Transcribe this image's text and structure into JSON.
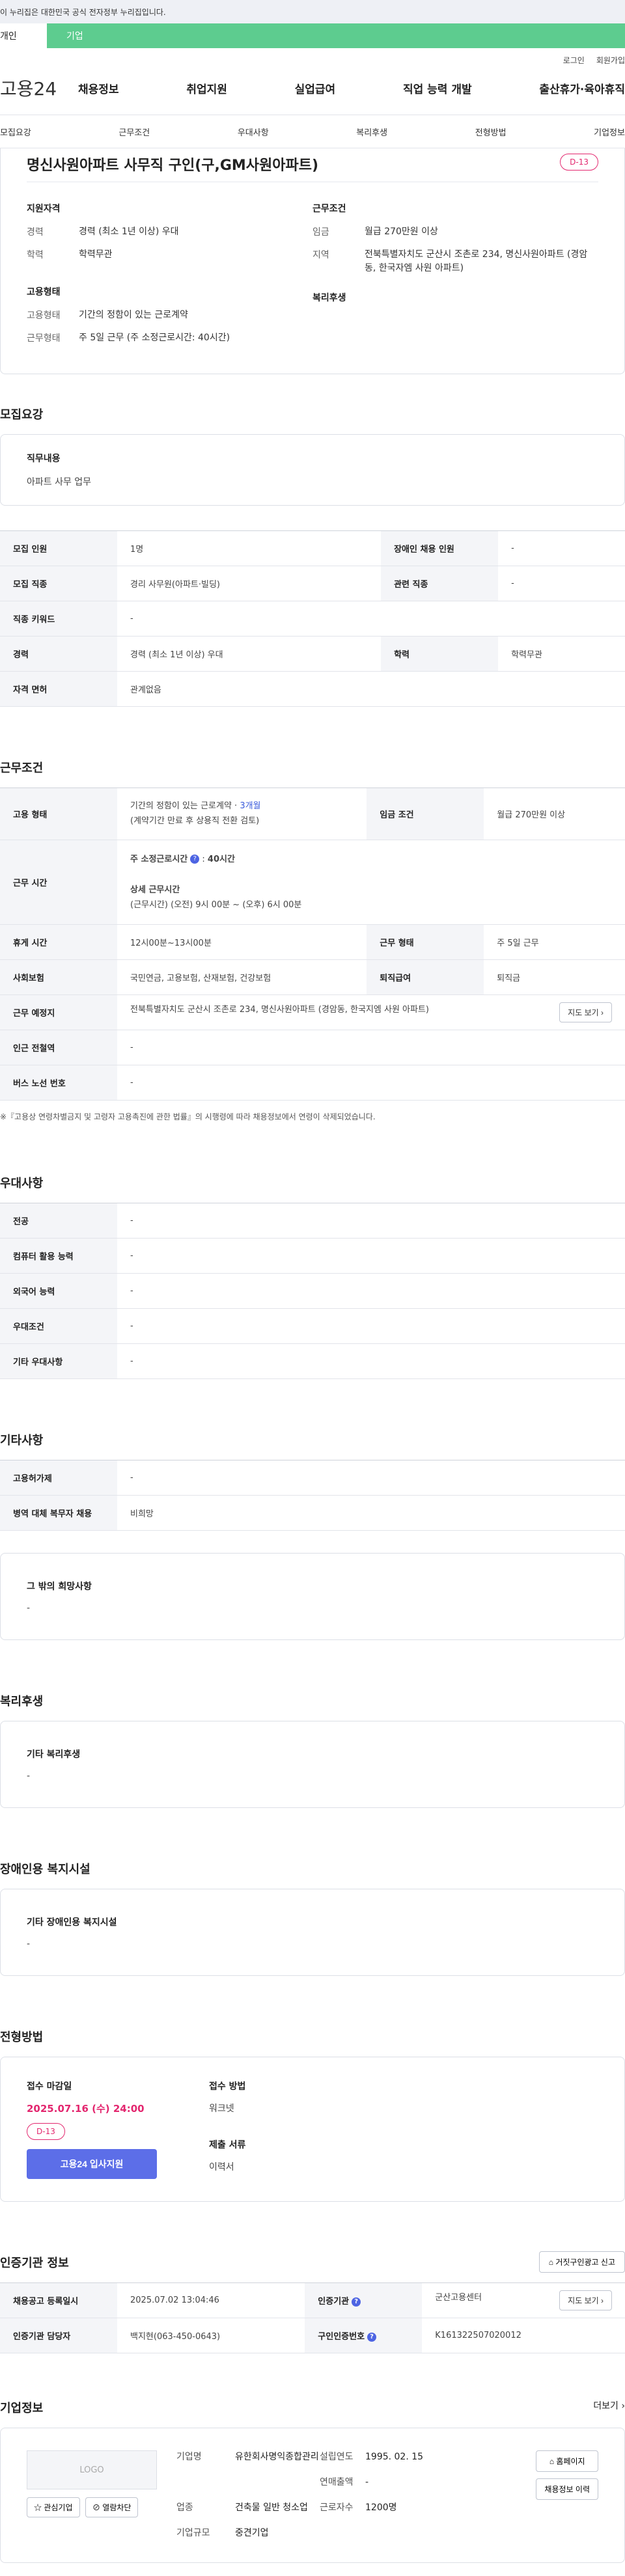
{
  "banner": "이 누리집은 대한민국 공식 전자정부 누리집입니다.",
  "user_tabs": [
    "개인",
    "기업"
  ],
  "util": [
    "로그인",
    "회원가입"
  ],
  "logo": "고용24",
  "gnb": [
    "채용정보",
    "취업지원",
    "실업급여",
    "직업 능력 개발",
    "출산휴가·육아휴직"
  ],
  "tabs": [
    "모집요강",
    "근무조건",
    "우대사항",
    "복리후생",
    "전형방법",
    "기업정보"
  ],
  "job": {
    "title": "명신사원아파트 사무직 구인(구,GM사원아파트)",
    "dday": "D-13",
    "support_head": "지원자격",
    "career_k": "경력",
    "career_v": "경력 (최소 1년 이상) 우대",
    "edu_k": "학력",
    "edu_v": "학력무관",
    "cond_head": "근무조건",
    "wage_k": "임금",
    "wage_v": "월급 270만원 이상",
    "loc_k": "지역",
    "loc_v": "전북특별자치도 군산시 조촌로 234, 명신사원아파트 (경암동, 한국자엠 사원 아파트)",
    "emp_head": "고용형태",
    "emptype_k": "고용형태",
    "emptype_v": "기간의 정함이 있는 근로계약",
    "worktype_k": "근무형태",
    "worktype_v": "주 5일 근무 (주 소정근로시간: 40시간)",
    "welfare_head": "복리후생"
  },
  "recruit": {
    "title": "모집요강",
    "duty_h": "직무내용",
    "duty_b": "아파트 사무 업무",
    "rows": [
      {
        "k1": "모집 인원",
        "v1": "1명",
        "k2": "장애인 채용 인원",
        "v2": "-"
      },
      {
        "k1": "모집 직종",
        "v1": "경리 사무원(아파트·빌딩)",
        "k2": "관련 직종",
        "v2": "-"
      },
      {
        "k1": "직종 키워드",
        "v1": "-"
      },
      {
        "k1": "경력",
        "v1": "경력 (최소 1년 이상) 우대",
        "k2": "학력",
        "v2": "학력무관"
      },
      {
        "k1": "자격 면허",
        "v1": "관계없음"
      }
    ]
  },
  "work": {
    "title": "근무조건",
    "emp_k": "고용 형태",
    "emp_v1": "기간의 정함이 있는 근로계약 · ",
    "emp_v1b": "3개월",
    "emp_v2": "(계약기간 만료 후 상용직 전환 검토)",
    "wage_k": "임금 조건",
    "wage_v": "월급 270만원 이상",
    "hours_k": "근무 시간",
    "hours_a": "주 소정근로시간",
    "hours_a2": "40시간",
    "hours_b": "상세 근무시간",
    "hours_c": "(근무시간) (오전) 9시 00분 ~ (오후) 6시 00분",
    "rest_k": "휴게 시간",
    "rest_v": "12시00분~13시00분",
    "form_k": "근무 형태",
    "form_v": "주 5일 근무",
    "ins_k": "사회보험",
    "ins_v": "국민연금, 고용보험, 산재보험, 건강보험",
    "sev_k": "퇴직급여",
    "sev_v": "퇴직금",
    "place_k": "근무 예정지",
    "place_v": "전북특별자치도 군산시 조촌로 234, 명신사원아파트 (경암동, 한국지엠 사원 아파트)",
    "map_btn": "지도 보기 ›",
    "sub_k": "인근 전철역",
    "sub_v": "-",
    "bus_k": "버스 노선 번호",
    "bus_v": "-",
    "note": "※『고용상 연령차별금지 및 고령자 고용촉진에 관한 법률』의 시행령에 따라 채용정보에서 연령이 삭제되었습니다."
  },
  "pref": {
    "title": "우대사항",
    "rows": [
      {
        "k": "전공",
        "v": "-"
      },
      {
        "k": "컴퓨터 활용 능력",
        "v": "-"
      },
      {
        "k": "외국어 능력",
        "v": "-"
      },
      {
        "k": "우대조건",
        "v": "-"
      },
      {
        "k": "기타 우대사항",
        "v": "-"
      }
    ]
  },
  "etc": {
    "title": "기타사항",
    "rows": [
      {
        "k": "고용허가제",
        "v": "-"
      },
      {
        "k": "병역 대체 복무자 채용",
        "v": "비희망"
      }
    ],
    "hope_h": "그 밖의 희망사항",
    "hope_b": "-"
  },
  "welfare": {
    "title": "복리후생",
    "h": "기타 복리후생",
    "b": "-"
  },
  "disab": {
    "title": "장애인용 복지시설",
    "h": "기타 장애인용 복지시설",
    "b": "-"
  },
  "select": {
    "title": "전형방법",
    "deadline_h": "접수 마감일",
    "deadline_v": "2025.07.16 (수) 24:00",
    "dday": "D-13",
    "apply": "고용24 입사지원",
    "method_h": "접수 방법",
    "method_v": "워크넷",
    "docs_h": "제출 서류",
    "docs_v": "이력서"
  },
  "cert": {
    "title": "인증기관 정보",
    "report": "거짓구인광고 신고",
    "r1k1": "채용공고 등록일시",
    "r1v1": "2025.07.02 13:04:46",
    "r1k2": "인증기관",
    "r1v2": "군산고용센터",
    "map_btn": "지도 보기 ›",
    "r2k1": "인증기관 담당자",
    "r2v1": "백지현(063-450-0643)",
    "r2k2": "구인인증번호",
    "r2v2": "K161322507020012"
  },
  "company": {
    "title": "기업정보",
    "more": "더보기 ›",
    "logo": "LOGO",
    "fav": "☆ 관심기업",
    "block": "⊘ 열람차단",
    "name_k": "기업명",
    "name_v": "유한회사명익종합관리",
    "found_k": "설립연도",
    "found_v": "1995. 02. 15",
    "sales_k": "연매출액",
    "sales_v": "-",
    "ind_k": "업종",
    "ind_v": "건축물 일반 청소업",
    "emp_k": "근로자수",
    "emp_v": "1200명",
    "size_k": "기업규모",
    "size_v": "중견기업",
    "home": "홈페이지",
    "history": "채용정보 이력"
  }
}
